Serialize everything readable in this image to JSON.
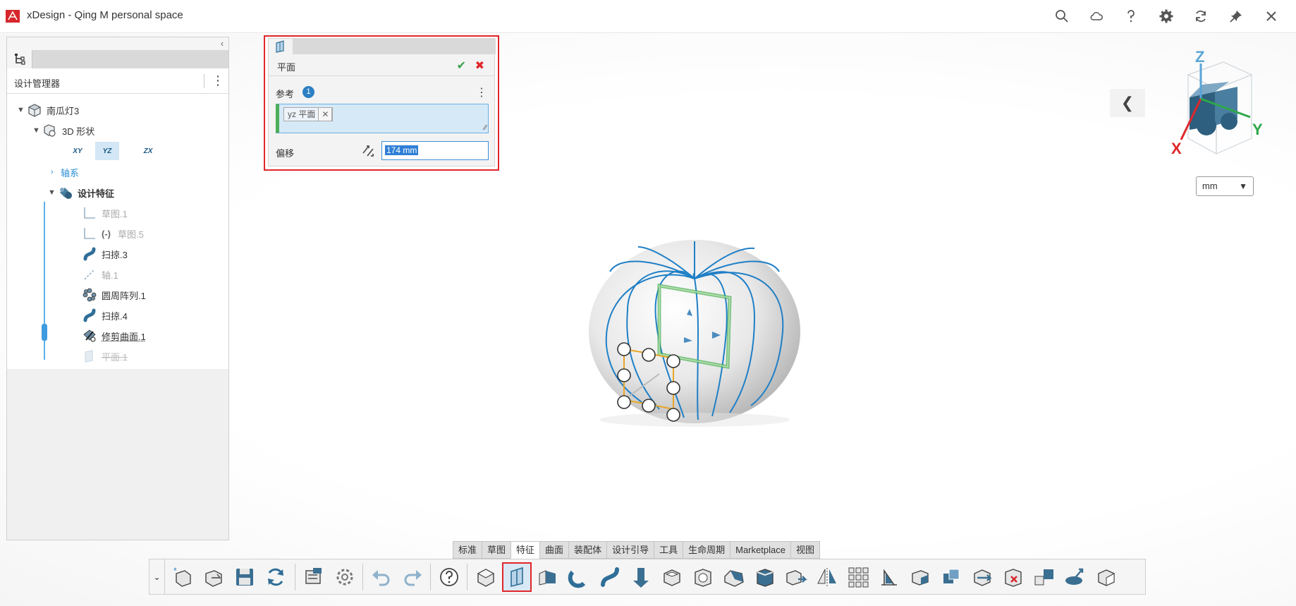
{
  "app": {
    "title": "xDesign - Qing M personal space"
  },
  "titlebar_icons": [
    "search-icon",
    "cloud-icon",
    "help-icon",
    "settings-icon",
    "refresh-icon",
    "pin-icon",
    "close-icon"
  ],
  "left_panel": {
    "header": "设计管理器",
    "tree": {
      "root": "南瓜灯3",
      "shape": "3D 形状",
      "planes": [
        "XY",
        "YZ",
        "ZX"
      ],
      "axes": "轴系",
      "features_group": "设计特征",
      "features": [
        {
          "label": "草图.1",
          "state": "faded",
          "icon": "sketch-icon"
        },
        {
          "label": "草图.5",
          "prefix": "(-)",
          "state": "faded",
          "icon": "sketch-icon"
        },
        {
          "label": "扫掠.3",
          "state": "normal",
          "icon": "sweep-icon"
        },
        {
          "label": "轴.1",
          "state": "faded",
          "icon": "axis-icon"
        },
        {
          "label": "圆周阵列.1",
          "state": "normal",
          "icon": "circular-pattern-icon"
        },
        {
          "label": "扫掠.4",
          "state": "normal",
          "icon": "sweep-icon"
        },
        {
          "label": "修剪曲面.1",
          "state": "active",
          "icon": "trim-surface-icon"
        },
        {
          "label": "平面.1",
          "state": "rolled-back",
          "icon": "plane-icon"
        }
      ]
    }
  },
  "dialog": {
    "title": "平面",
    "reference_label": "参考",
    "reference_count": "1",
    "reference_chip": "yz 平面",
    "offset_label": "偏移",
    "offset_value": "174 mm"
  },
  "unit_selector": {
    "value": "mm"
  },
  "triad": {
    "x": "X",
    "y": "Y",
    "z": "Z"
  },
  "command_tabs": {
    "items": [
      "标准",
      "草图",
      "特征",
      "曲面",
      "装配体",
      "设计引导",
      "工具",
      "生命周期",
      "Marketplace",
      "视图"
    ],
    "active": "特征"
  },
  "toolbar": {
    "selected_tool": "plane-tool",
    "tools": [
      "new-icon",
      "open-icon",
      "save-icon",
      "rebuild-icon",
      "options-icon",
      "settings-icon",
      "undo-icon",
      "redo-icon",
      "help-icon",
      "extrude-icon",
      "plane-icon",
      "extrude-cut-icon",
      "revolve-icon",
      "sweep-icon",
      "boss-icon",
      "shell-icon",
      "hole-icon",
      "chamfer-icon",
      "fillet-icon",
      "move-face-icon",
      "mirror-icon",
      "pattern-icon",
      "rib-icon",
      "draft-icon",
      "combine-icon",
      "split-icon",
      "delete-body-icon",
      "move-body-icon",
      "measure-icon",
      "body-icon"
    ]
  },
  "colors": {
    "accent": "#2b7fc4",
    "highlight_border": "#e0262b",
    "confirm": "#3aa04a",
    "model_edges": "#1f7fc6",
    "selection_green": "#4cae5a",
    "sketch_orange": "#e8a628"
  }
}
